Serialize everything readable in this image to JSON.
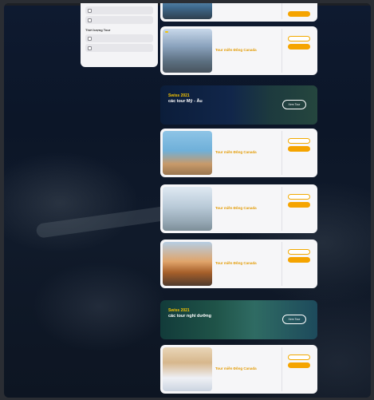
{
  "filter": {
    "top_options": [
      "",
      ""
    ],
    "section_title": "Thời lượng Tour",
    "options": [
      "",
      ""
    ]
  },
  "tour": {
    "name": "Tour miền Đông Canada",
    "code": "",
    "rating": "",
    "duration": "",
    "transport": "",
    "departure_label": "",
    "dates": [],
    "price_old": "",
    "price": "",
    "per": "",
    "detail_label": "",
    "book_label": "",
    "more_label": "",
    "badge": ""
  },
  "banners": [
    {
      "line1": "Swiss 2021",
      "line2": "các tour Mỹ - Âu",
      "sub": "",
      "button": "Xem Tour"
    },
    {
      "line1": "Swiss 2021",
      "line2": "các tour nghỉ dưỡng",
      "sub": "",
      "button": "Xem Tour"
    }
  ],
  "colors": {
    "accent": "#f5a400",
    "price": "#d03030",
    "background": "#0e1a30"
  }
}
